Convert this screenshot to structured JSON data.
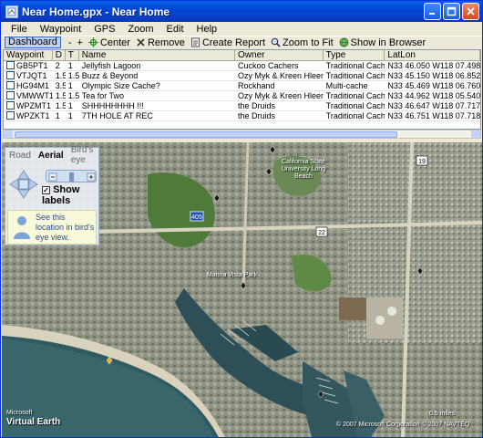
{
  "window": {
    "title": "Near Home.gpx - Near Home"
  },
  "menu": [
    "File",
    "Waypoint",
    "GPS",
    "Zoom",
    "Edit",
    "Help"
  ],
  "toolbar": {
    "dashboard": "Dashboard",
    "minus": "-",
    "plus": "+",
    "center": "Center",
    "remove": "Remove",
    "create_report": "Create Report",
    "zoom_to_fit": "Zoom to Fit",
    "show_in_browser": "Show in Browser"
  },
  "grid": {
    "columns": [
      "Waypoint",
      "D",
      "T",
      "Name",
      "Owner",
      "Type",
      "LatLon"
    ],
    "rows": [
      [
        "GB5PT1",
        "2",
        "1",
        "Jellyfish Lagoon",
        "Cuckoo Cachers",
        "Traditional Cache",
        "N33 46.050 W118 07.498"
      ],
      [
        "VTJQT1",
        "1.5",
        "1.5",
        "Buzz & Beyond",
        "Ozy Myk & Kreen Hleen",
        "Traditional Cache",
        "N33 45.150 W118 06.852"
      ],
      [
        "HG94M1",
        "3.5",
        "1",
        "Olympic Size Cache?",
        "Rockhand",
        "Multi-cache",
        "N33 45.469 W118 06.760"
      ],
      [
        "VMWWT1",
        "1.5",
        "1.5",
        "Tea for Two",
        "Ozy Myk & Kreen Hleen",
        "Traditional Cache",
        "N33 44.962 W118 05.540"
      ],
      [
        "WPZMT1",
        "1.5",
        "1",
        "SHHHHHHHH !!!",
        "the Druids",
        "Traditional Cache",
        "N33 46.647 W118 07.717"
      ],
      [
        "WPZKT1",
        "1",
        "1",
        "7TH HOLE AT REC",
        "the Druids",
        "Traditional Cache",
        "N33 46.751 W118 07.718"
      ]
    ]
  },
  "map_control": {
    "tabs": [
      "Road",
      "Aerial",
      "Bird's eye"
    ],
    "active_tab": "Aerial",
    "show_labels": "Show labels",
    "show_labels_checked": true,
    "birds_eye_tip": "See this location in bird's eye view."
  },
  "map": {
    "labels": {
      "csulb": "California State University Long Beach",
      "marina": "Marina Vista Park",
      "route_405": "405",
      "route_22": "22",
      "route_19": "19"
    },
    "logo": "Virtual Earth",
    "logo_small": "Microsoft",
    "copyright": "© 2007 Microsoft Corporation © 2007 NAVTEQ",
    "scale": "0.5 miles"
  }
}
